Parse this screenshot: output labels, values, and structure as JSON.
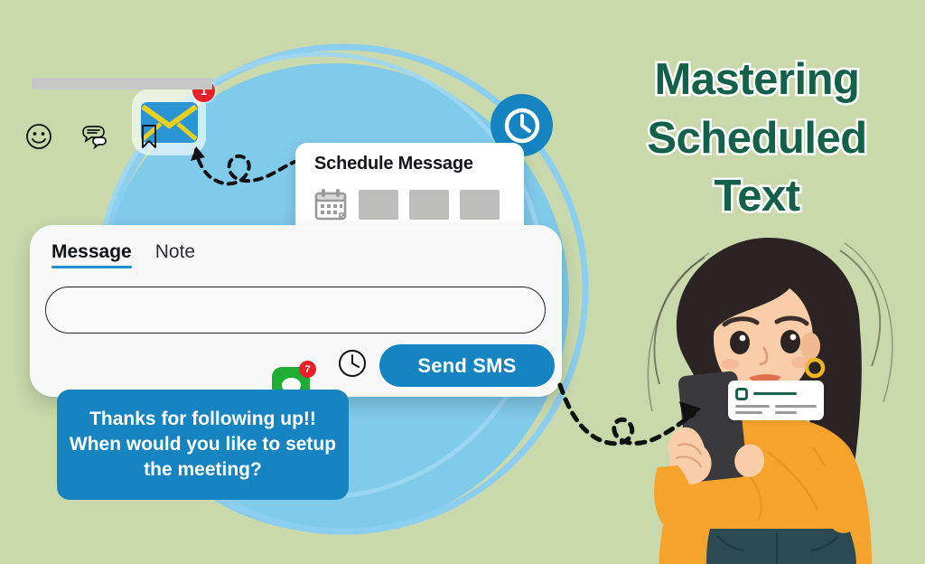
{
  "background": {
    "color": "#c9d9ac",
    "ring_color": "#86cbee",
    "blob_color": "#79c9ef"
  },
  "headline": {
    "lines": [
      "Mastering",
      "Scheduled",
      "Text"
    ],
    "color": "#14614a",
    "outline_color": "#ffffff"
  },
  "email_icon": {
    "name": "envelope-icon",
    "badge_count": "1",
    "badge_color": "#e8202a",
    "envelope_color": "#2a94d4",
    "flap_color": "#e8cf1e"
  },
  "clock_badge": {
    "name": "clock-icon",
    "color": "#1584c0"
  },
  "schedule_card": {
    "title": "Schedule Message",
    "calendar_icon": "calendar-icon",
    "slots": [
      "",
      "",
      ""
    ]
  },
  "message_card": {
    "tabs": [
      {
        "label": "Message",
        "active": true
      },
      {
        "label": "Note",
        "active": false
      }
    ],
    "active_tab_underline_color": "#1e8fd0",
    "input": {
      "value": "",
      "placeholder": ""
    },
    "toolbar_icons": [
      "smiley-icon",
      "chat-templates-icon",
      "bookmark-icon"
    ],
    "schedule_clock_icon": "clock-icon",
    "send_button": {
      "label": "Send SMS",
      "color": "#1584c0"
    }
  },
  "green_chat_icon": {
    "name": "messages-app-icon",
    "badge_count": "7",
    "color": "#1eae36",
    "badge_color": "#e8202a"
  },
  "chat_bubble": {
    "text": "Thanks for following up!! When would you like to setup the meeting?",
    "color": "#1584c0"
  },
  "arrows": {
    "left_arrow": "dashed-curved-arrow-icon",
    "right_arrow": "dashed-curved-arrow-icon"
  },
  "illustration": {
    "name": "woman-holding-phone-illustration",
    "hair_color": "#2b2422",
    "sweater_color": "#f5a32a",
    "jeans_color": "#2c4a54",
    "skin_color": "#f6c9a2",
    "phone_color": "#3a3a3e",
    "earring_color": "#f2b521"
  },
  "phone_notification": {
    "icon": "app-square-icon",
    "title_bar_color": "#18614c",
    "line_color": "#9a9a9a"
  }
}
